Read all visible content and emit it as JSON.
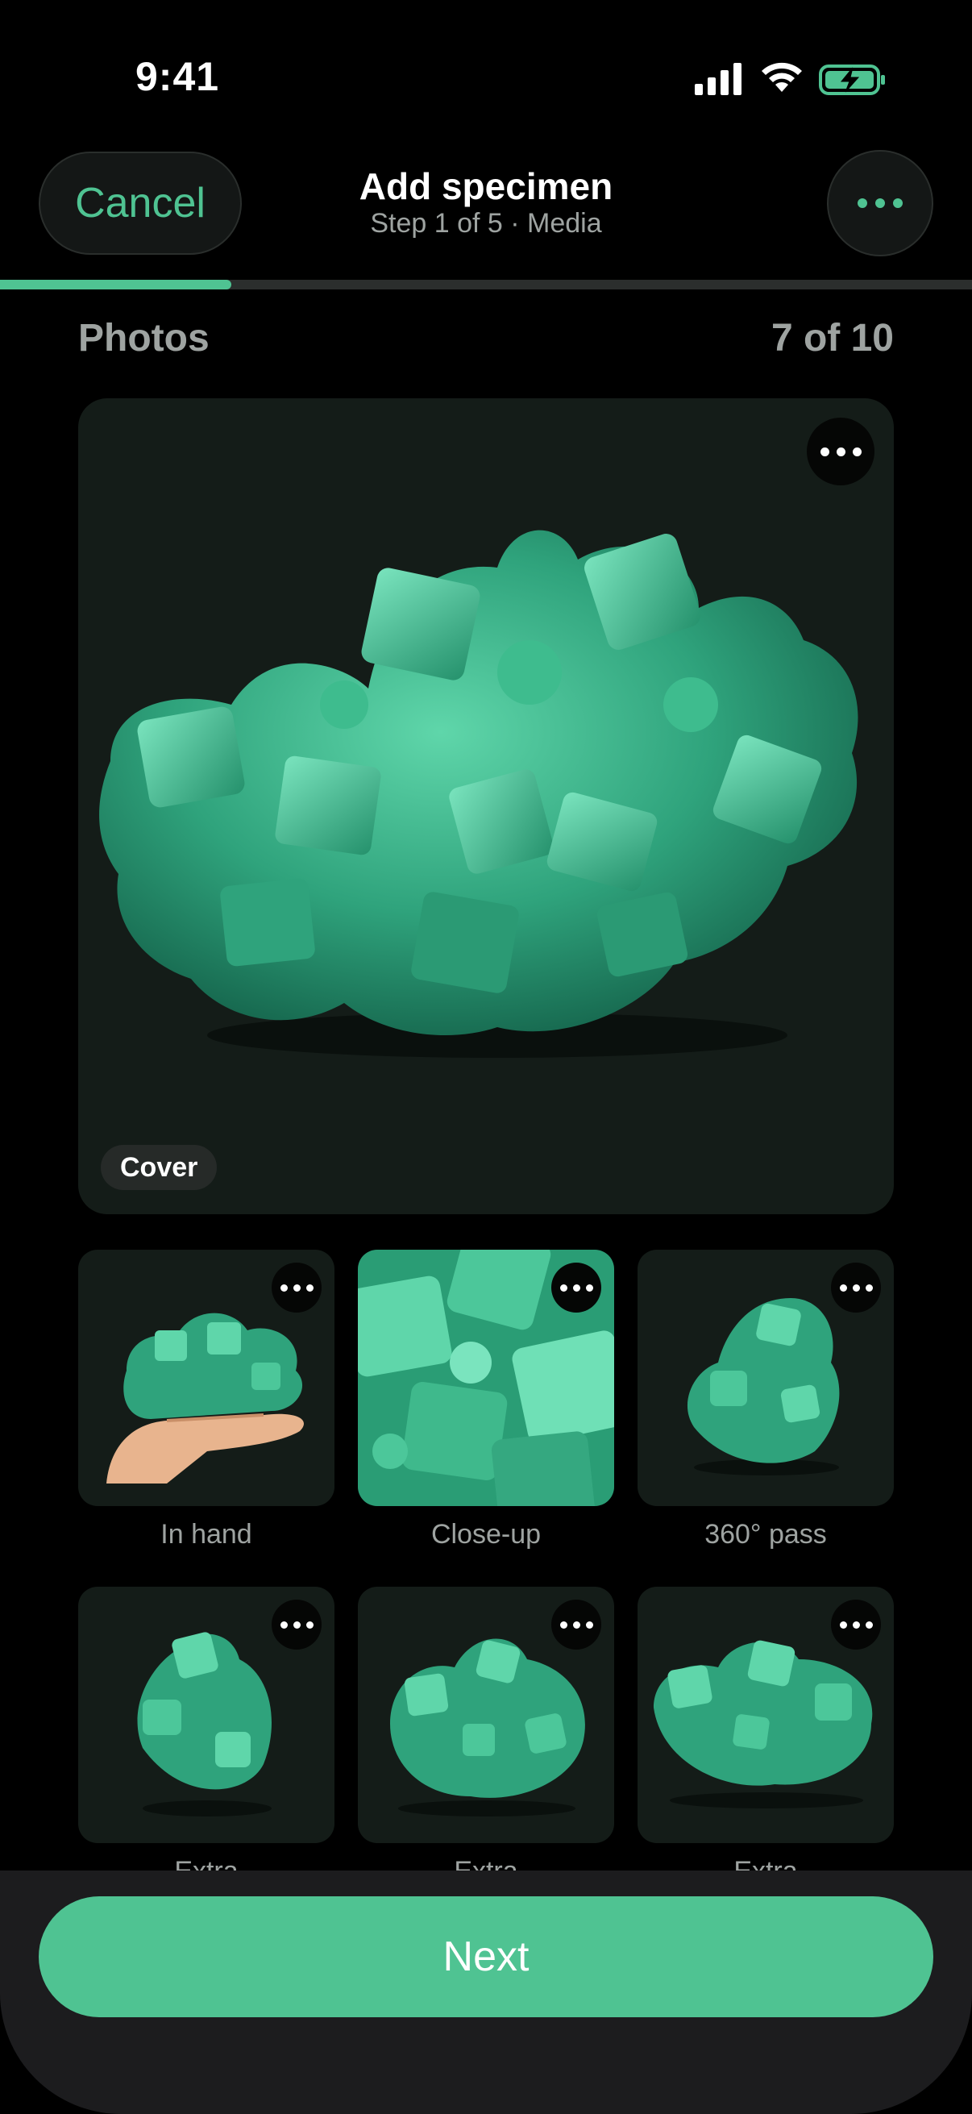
{
  "status_bar": {
    "time": "9:41",
    "icons": [
      "signal-icon",
      "wifi-icon",
      "battery-charging-icon"
    ]
  },
  "header": {
    "cancel_label": "Cancel",
    "title": "Add specimen",
    "subtitle": "Step 1 of 5 · Media",
    "more_icon": "ellipsis-icon",
    "progress": 0.2
  },
  "photos": {
    "heading": "Photos",
    "count": "7 of 10",
    "cover": {
      "badge": "Cover"
    },
    "tiles": [
      {
        "label": "In hand"
      },
      {
        "label": "Close-up"
      },
      {
        "label": "360° pass"
      },
      {
        "label": "Extra"
      },
      {
        "label": "Extra"
      },
      {
        "label": "Extra"
      }
    ]
  },
  "footer": {
    "next_label": "Next"
  },
  "colors": {
    "accent": "#4fc392",
    "background": "#000000",
    "card": "#141c18",
    "mineral": "#2fa37c"
  }
}
